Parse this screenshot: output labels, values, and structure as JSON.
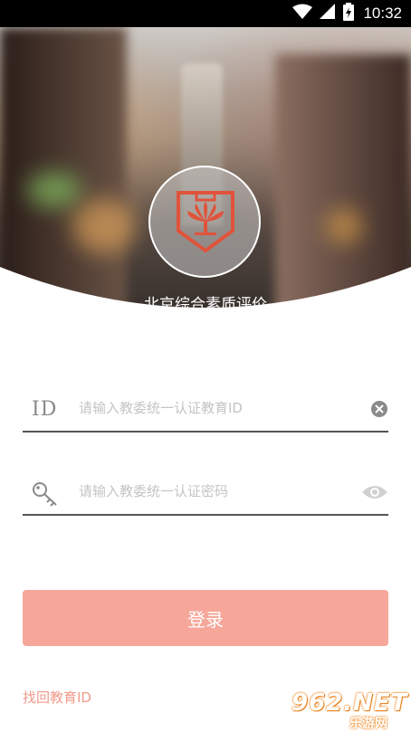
{
  "status_bar": {
    "time": "10:32"
  },
  "header": {
    "app_title": "北京综合素质评价"
  },
  "form": {
    "id_field": {
      "label": "ID",
      "placeholder": "请输入教委统一认证教育ID"
    },
    "password_field": {
      "placeholder": "请输入教委统一认证密码"
    }
  },
  "login_button": {
    "label": "登录"
  },
  "forgot_link": {
    "label": "找回教育ID"
  },
  "watermark": {
    "text_top": "962.NET",
    "text_bottom": "乐游网"
  },
  "colors": {
    "accent": "#f6a79a",
    "link": "#f29a8a",
    "logo_red": "#e0533b"
  },
  "icons": [
    "wifi-icon",
    "signal-icon",
    "battery-charging-icon",
    "logo-emblem-icon",
    "key-icon",
    "clear-icon",
    "eye-icon"
  ]
}
